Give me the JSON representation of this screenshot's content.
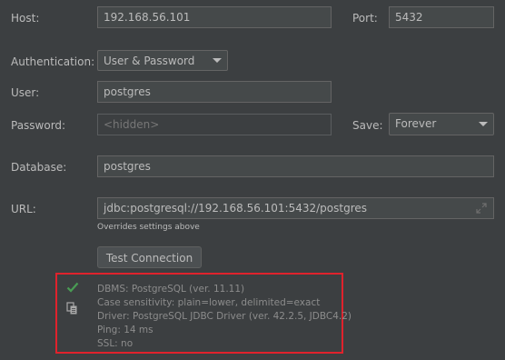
{
  "host": {
    "label": "Host:",
    "value": "192.168.56.101"
  },
  "port": {
    "label": "Port:",
    "value": "5432"
  },
  "authentication": {
    "label": "Authentication:",
    "value": "User & Password"
  },
  "user": {
    "label": "User:",
    "value": "postgres"
  },
  "password": {
    "label": "Password:",
    "placeholder": "<hidden>"
  },
  "save": {
    "label": "Save:",
    "value": "Forever"
  },
  "database": {
    "label": "Database:",
    "value": "postgres"
  },
  "url": {
    "label": "URL:",
    "value": "jdbc:postgresql://192.168.56.101:5432/postgres",
    "hint": "Overrides settings above"
  },
  "test_button": {
    "label": "Test Connection"
  },
  "result": {
    "lines": [
      "DBMS: PostgreSQL (ver. 11.11)",
      "Case sensitivity: plain=lower, delimited=exact",
      "Driver: PostgreSQL JDBC Driver (ver. 42.2.5, JDBC4.2)",
      "Ping: 14 ms",
      "SSL: no"
    ]
  },
  "icons": {
    "success": "check-icon",
    "copy": "copy-icon",
    "expand": "expand-icon"
  },
  "colors": {
    "background": "#3c3f41",
    "field": "#45494a",
    "success": "#499c54",
    "highlight_border": "#e0222c"
  }
}
